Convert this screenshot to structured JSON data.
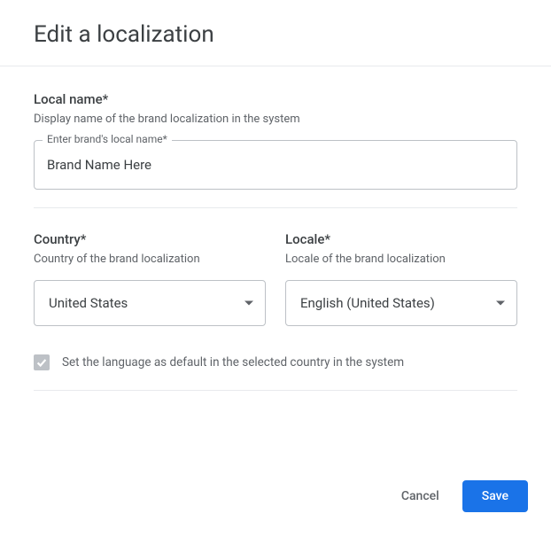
{
  "dialog": {
    "title": "Edit a localization"
  },
  "localName": {
    "label": "Local name*",
    "help": "Display name of the brand localization in the system",
    "floatLabel": "Enter brand's local name*",
    "value": "Brand Name Here"
  },
  "country": {
    "label": "Country*",
    "help": "Country of the brand localization",
    "selected": "United States"
  },
  "locale": {
    "label": "Locale*",
    "help": "Locale of the brand localization",
    "selected": "English (United States)"
  },
  "defaultLang": {
    "checked": true,
    "label": "Set the language as default in the selected country in the system"
  },
  "buttons": {
    "cancel": "Cancel",
    "save": "Save"
  }
}
